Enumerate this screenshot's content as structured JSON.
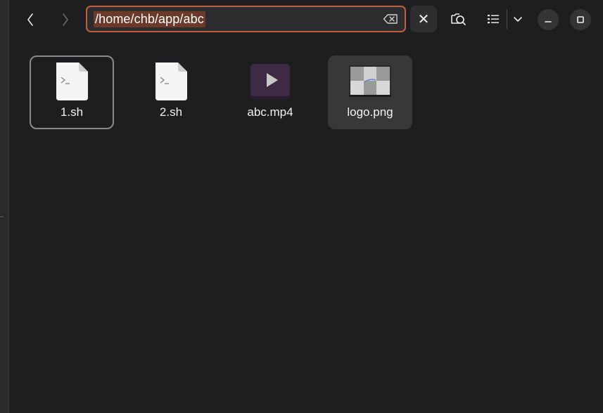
{
  "header": {
    "back_icon": "chevron-left-icon",
    "forward_icon": "chevron-right-icon",
    "location_path": "/home/chb/app/abc",
    "clear_icon": "backspace-icon",
    "close_icon": "close-icon",
    "close_glyph": "✕",
    "search_icon": "search-icon",
    "view_icon": "list-view-icon",
    "view_dropdown_icon": "chevron-down-icon",
    "minimize_icon": "minimize-icon",
    "maximize_icon": "maximize-icon"
  },
  "files": [
    {
      "name": "1.sh",
      "kind": "script",
      "state": "focused"
    },
    {
      "name": "2.sh",
      "kind": "script",
      "state": "normal"
    },
    {
      "name": "abc.mp4",
      "kind": "video",
      "state": "normal"
    },
    {
      "name": "logo.png",
      "kind": "image",
      "state": "selected"
    }
  ],
  "colors": {
    "background": "#1e1e20",
    "location_border": "#c0603e",
    "text_selection": "#6b3a2b",
    "video_icon": "#3e2a44"
  }
}
